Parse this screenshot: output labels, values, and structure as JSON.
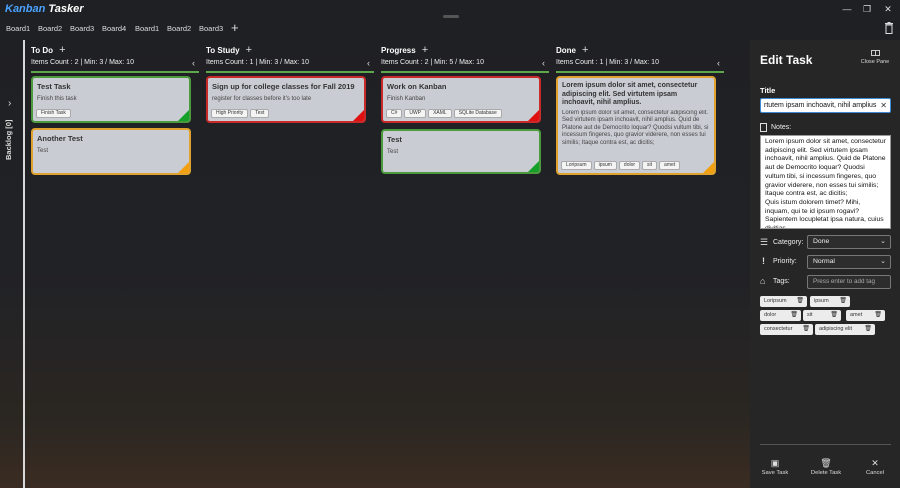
{
  "app": {
    "title_part1": "Kanban",
    "title_part2": "Tasker"
  },
  "window": {
    "minimize": "—",
    "maximize": "❐",
    "close": "✕"
  },
  "tabs": [
    "Board1",
    "Board2",
    "Board3",
    "Board4",
    "Board1",
    "Board2",
    "Board3"
  ],
  "add_board": "+",
  "backlog": {
    "label": "Backlog [0]",
    "chevron": "›"
  },
  "columns": [
    {
      "title": "To Do",
      "info": "Items Count : 2  |  Min: 3 / Max: 10",
      "cards": [
        {
          "title": "Test Task",
          "desc": "Finish this task",
          "tags": [
            "Finish Task"
          ],
          "priority_color": "green"
        },
        {
          "title": "Another Test",
          "desc": "Test",
          "tags": [],
          "priority_color": "orange"
        }
      ]
    },
    {
      "title": "To Study",
      "info": "Items Count : 1  |  Min: 3 / Max: 10",
      "cards": [
        {
          "title": "Sign up for college classes for Fall 2019",
          "desc": "register for classes before it's too late",
          "tags": [
            "High Priority",
            "Test"
          ],
          "priority_color": "red"
        }
      ]
    },
    {
      "title": "Progress",
      "info": "Items Count : 2  |  Min: 5 / Max: 10",
      "cards": [
        {
          "title": "Work on Kanban",
          "desc": "Finish Kanban",
          "tags": [
            "C#",
            "UWP",
            "XAML",
            "SQLite Database"
          ],
          "priority_color": "red"
        },
        {
          "title": "Test",
          "desc": "Test",
          "tags": [],
          "priority_color": "green"
        }
      ]
    },
    {
      "title": "Done",
      "info": "Items Count : 1  |  Min: 3 / Max: 10",
      "cards": [
        {
          "title": "Lorem ipsum dolor sit amet, consectetur adipiscing elit. Sed virtutem ipsam inchoavit, nihil amplius.",
          "desc": "Lorem ipsum dolor sit amet, consectetur adipiscing elit. Sed virtutem ipsam inchoavit, nihil amplius. Quid de Platone aut de Democrito loquar? Quodsi vultum tibi, si incessum fingeres, quo gravior viderere, non esses tui similis; Itaque contra est, ac dicitis;",
          "tags": [
            "Loripsum",
            "ipsum",
            "dolor",
            "sit",
            "amet"
          ],
          "priority_color": "orange"
        }
      ]
    }
  ],
  "edit_pane": {
    "heading": "Edit Task",
    "close_pane": "Close Pane",
    "title_label": "Title",
    "title_value": "rtutem ipsam inchoavit, nihil amplius",
    "notes_label": "Notes:",
    "notes_value": "Lorem ipsum dolor sit amet, consectetur adipiscing elit. Sed virtutem ipsam inchoavit, nihil amplius. Quid de Platone aut de Democrito loquar? Quodsi vultum tibi, si incessum fingeres, quo gravior viderere, non esses tui similis; Itaque contra est, ac dicitis;\nQuis istum dolorem timet? Mihi, inquam, qui te id ipsum rogavi? Sapientem locupletat ipsa natura, cuius divitias",
    "category_label": "Category:",
    "category_value": "Done",
    "priority_label": "Priority:",
    "priority_value": "Normal",
    "tags_label": "Tags:",
    "tags_placeholder": "Press enter to add tag",
    "tags": [
      "Loripsum",
      "ipsum",
      "dolor",
      "sit",
      "amet",
      "consectetur",
      "adipiscing elit"
    ],
    "save_label": "Save Task",
    "delete_label": "Delete Task",
    "cancel_label": "Cancel"
  },
  "colors": {
    "accent": "#4aa3ff",
    "column_rule": "#5ea84b",
    "green": "#15a02a",
    "red": "#e01010",
    "orange": "#f2a010",
    "card_bg": "#c9ccd3"
  }
}
